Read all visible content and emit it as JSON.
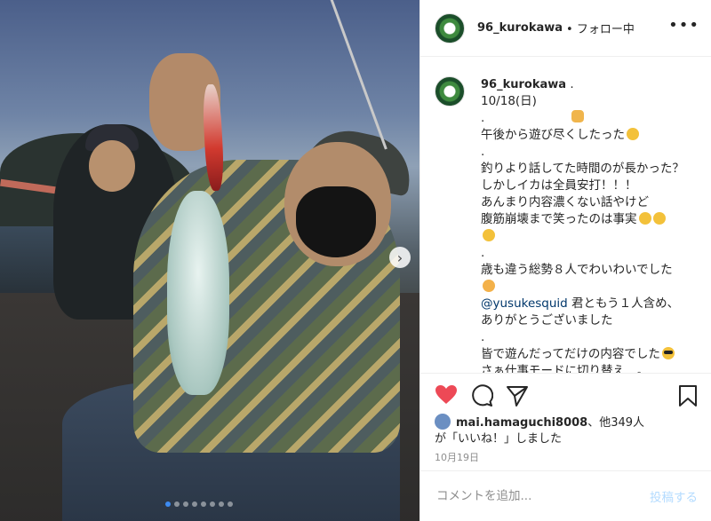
{
  "photo": {
    "next_icon": "chevron-right-icon",
    "carousel_total": 8,
    "carousel_active": 1
  },
  "header": {
    "username": "96_kurokawa",
    "follow_status": "• フォロー中",
    "more_icon": "more-horizontal-icon"
  },
  "caption": {
    "username": "96_kurokawa",
    "date": "10/18(日)",
    "lines": [
      ".",
      "午後から遊び尽くしたった",
      ".",
      "釣りより話してた時間のが長かった？",
      "しかしイカは全員安打！！！",
      "あんまり内容濃くない話やけど",
      "腹筋崩壊まで笑ったのは事実",
      ".",
      "歳も違う総勢８人でわいわいでした",
      "@yusukesquid",
      " 君ともう１人含め、",
      "ありがとうございました",
      ".",
      "皆で遊んだってだけの内容でした",
      "さぁ仕事モードに切り替え…。"
    ]
  },
  "actions": {
    "like_icon": "heart-filled-icon",
    "comment_icon": "comment-icon",
    "share_icon": "send-icon",
    "save_icon": "bookmark-icon",
    "like_color": "#ed4956"
  },
  "likes": {
    "user": "mai.hamaguchi8008",
    "others": "、他349人",
    "suffix": "が「いいね！」しました"
  },
  "post_date": "10月19日",
  "comment": {
    "placeholder": "コメントを追加...",
    "post_label": "投稿する"
  }
}
